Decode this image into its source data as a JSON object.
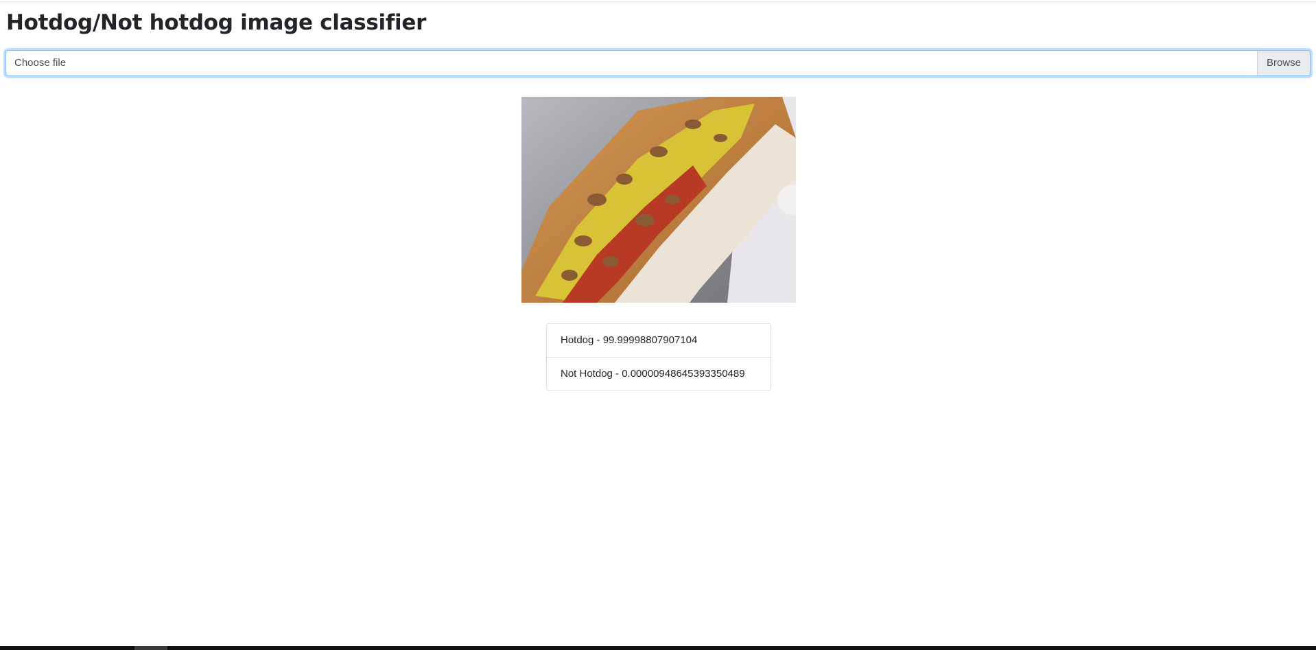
{
  "page": {
    "title": "Hotdog/Not hotdog image classifier"
  },
  "upload": {
    "placeholder": "Choose file",
    "browse_label": "Browse"
  },
  "image": {
    "subject": "hotdog photo"
  },
  "predictions": [
    {
      "label": "Hotdog - 99.99998807907104"
    },
    {
      "label": "Not Hotdog - 0.00000948645393350489"
    }
  ],
  "colors": {
    "focus_border": "#80bdff",
    "text": "#212529",
    "button_bg": "#e9ecef"
  }
}
